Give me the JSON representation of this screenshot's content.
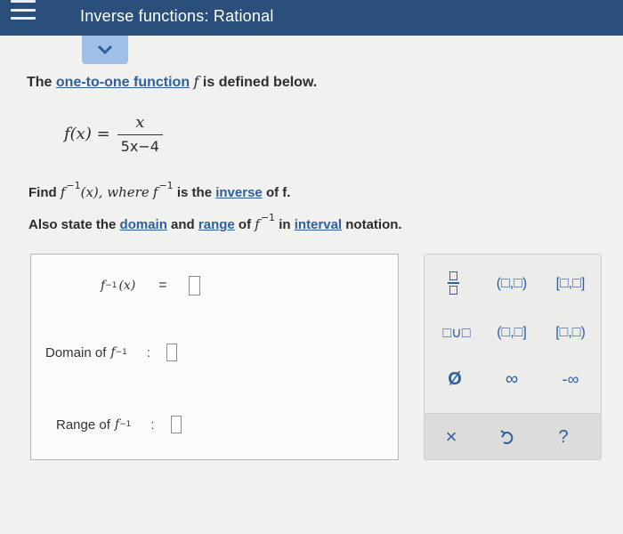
{
  "header": {
    "title": "Inverse functions: Rational"
  },
  "problem": {
    "intro_before": "The",
    "intro_link": "one-to-one function",
    "intro_f": "f",
    "intro_after": "is defined below.",
    "definition_lhs": "f(x) =",
    "numerator": "x",
    "denominator": "5x−4",
    "find_prefix": "Find",
    "f": "f",
    "inverse_sup": "−1",
    "arg_x": "(x), where",
    "is_the": "is the",
    "inverse_link": "inverse",
    "of_f": "of f.",
    "also_state": "Also state the",
    "domain_link": "domain",
    "and": "and",
    "range_link": "range",
    "of": "of",
    "in": "in",
    "interval_link": "interval",
    "notation": "notation."
  },
  "answers": {
    "inverse_lhs": "f",
    "inverse_sup": "−1",
    "inverse_arg": "(x)",
    "equals": "=",
    "domain_label": "Domain of",
    "range_label": "Range of",
    "colon": ":"
  },
  "keypad": {
    "open_open": "(□,□)",
    "closed_closed": "[□,□]",
    "union": "□∪□",
    "open_closed": "(□,□]",
    "closed_open": "[□,□)",
    "empty_set": "Ø",
    "infinity": "∞",
    "neg_infinity": "-∞",
    "clear": "×",
    "help": "?"
  },
  "colors": {
    "header_bg": "#2a4f7a",
    "accent": "#2f5f9d",
    "tab": "#9fbfe6"
  }
}
